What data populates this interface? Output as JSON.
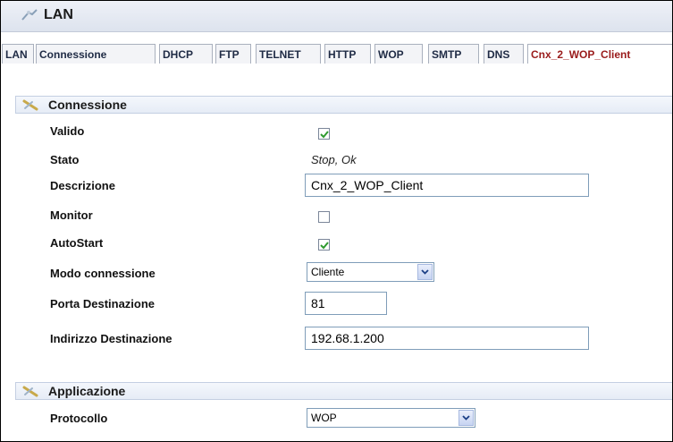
{
  "window": {
    "title": "LAN"
  },
  "tabs": [
    {
      "label": "LAN"
    },
    {
      "label": "Connessione"
    },
    {
      "label": "DHCP"
    },
    {
      "label": "FTP"
    },
    {
      "label": "TELNET"
    },
    {
      "label": "HTTP"
    },
    {
      "label": "WOP"
    },
    {
      "label": "SMTP"
    },
    {
      "label": "DNS"
    },
    {
      "label": "Cnx_2_WOP_Client",
      "active": true
    }
  ],
  "connessione": {
    "heading": "Connessione",
    "valido": {
      "label": "Valido",
      "checked": true
    },
    "stato": {
      "label": "Stato",
      "value": "Stop, Ok"
    },
    "descrizione": {
      "label": "Descrizione",
      "value": "Cnx_2_WOP_Client"
    },
    "monitor": {
      "label": "Monitor",
      "checked": false
    },
    "autostart": {
      "label": "AutoStart",
      "checked": true
    },
    "modo": {
      "label": "Modo connessione",
      "value": "Cliente"
    },
    "porta": {
      "label": "Porta Destinazione",
      "value": "81"
    },
    "indirizzo": {
      "label": "Indirizzo Destinazione",
      "value": "192.68.1.200"
    }
  },
  "applicazione": {
    "heading": "Applicazione",
    "protocollo": {
      "label": "Protocollo",
      "value": "WOP"
    }
  },
  "colors": {
    "active_tab": "#9a1b1b",
    "check": "#2e9a2e"
  },
  "icons": {
    "title": "network-icon",
    "section": "wrench-icon"
  }
}
